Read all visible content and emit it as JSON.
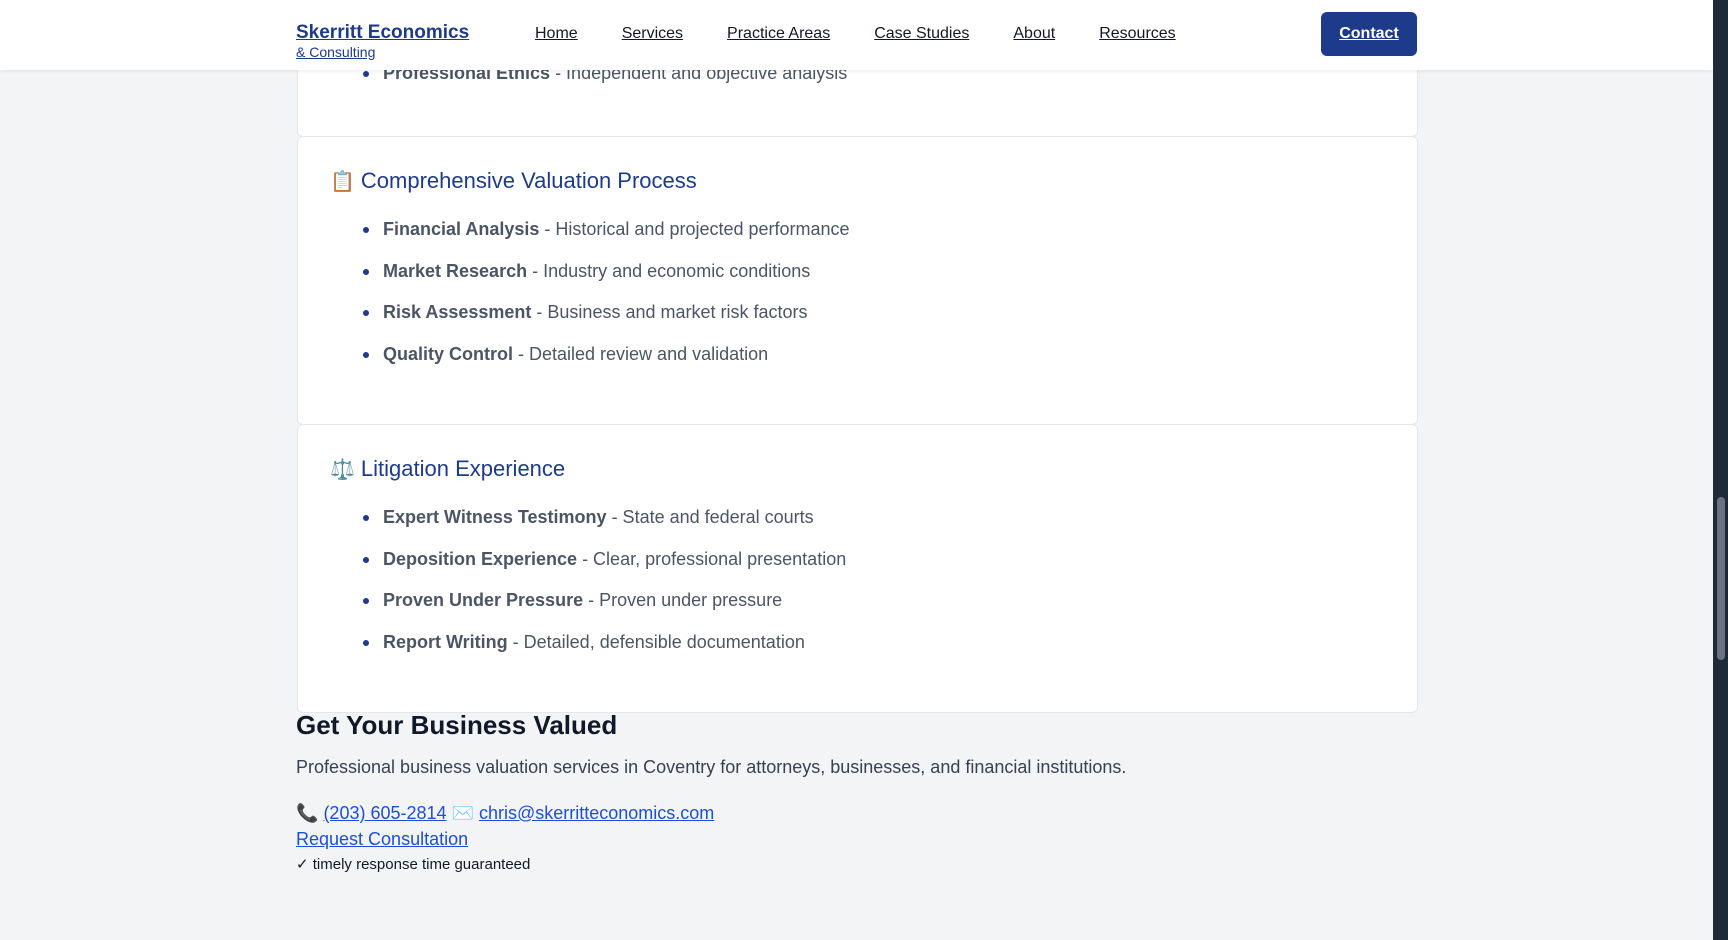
{
  "header": {
    "logo_main": "Skerritt Economics",
    "logo_sub": "& Consulting",
    "nav": [
      "Home",
      "Services",
      "Practice Areas",
      "Case Studies",
      "About",
      "Resources"
    ],
    "contact_label": "Contact"
  },
  "top_card": {
    "items": [
      {
        "term": "Professional Ethics",
        "desc": " - Independent and objective analysis"
      }
    ]
  },
  "valuation": {
    "icon": "📋",
    "title": "Comprehensive Valuation Process",
    "items": [
      {
        "term": "Financial Analysis",
        "desc": " - Historical and projected performance"
      },
      {
        "term": "Market Research",
        "desc": " - Industry and economic conditions"
      },
      {
        "term": "Risk Assessment",
        "desc": " - Business and market risk factors"
      },
      {
        "term": "Quality Control",
        "desc": " - Detailed review and validation"
      }
    ]
  },
  "litigation": {
    "icon": "⚖️",
    "title": "Litigation Experience",
    "items": [
      {
        "term": "Expert Witness Testimony",
        "desc": " - State and federal courts"
      },
      {
        "term": "Deposition Experience",
        "desc": " - Clear, professional presentation"
      },
      {
        "term": "Proven Under Pressure",
        "desc": " - Proven under pressure"
      },
      {
        "term": "Report Writing",
        "desc": " - Detailed, defensible documentation"
      }
    ]
  },
  "cta": {
    "title": "Get Your Business Valued",
    "text": "Professional business valuation services in Coventry for attorneys, businesses, and financial institutions.",
    "phone_icon": "📞",
    "phone": "(203) 605-2814",
    "email_icon": "✉️",
    "email": "chris@skerritteconomics.com",
    "request_label": "Request Consultation",
    "guarantee": "✓ timely response time guaranteed"
  }
}
